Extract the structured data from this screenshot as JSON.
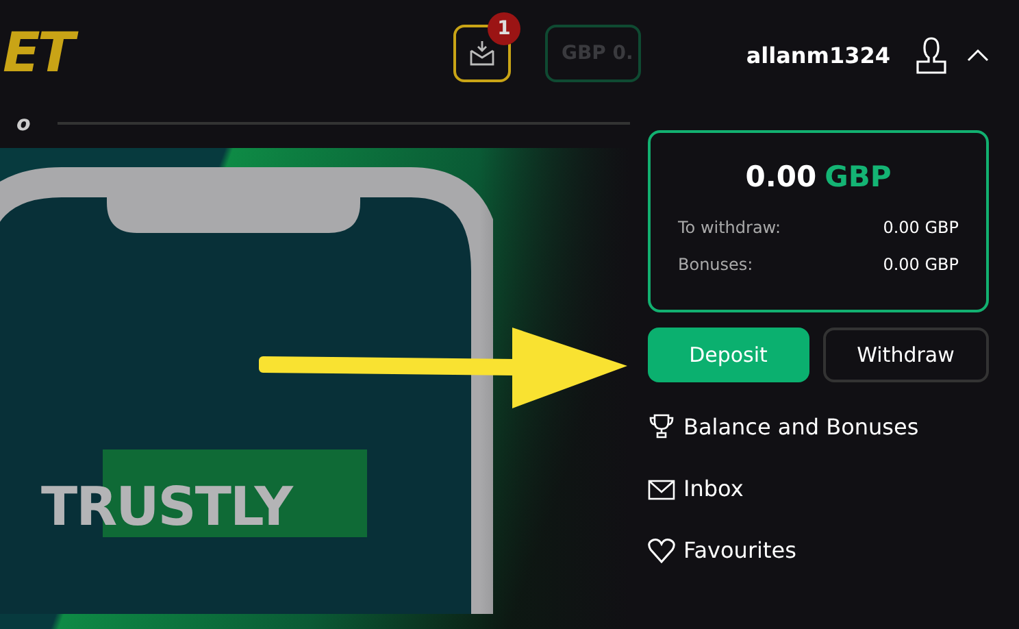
{
  "header": {
    "logo": "ET",
    "inbox": {
      "badge": "1"
    },
    "balance_button": "GBP 0.",
    "nav_item": "o"
  },
  "banner": {
    "headline": "TRUSTLY"
  },
  "account_menu": {
    "username": "allanm1324",
    "expanded": true,
    "balance": {
      "amount": "0.00",
      "currency": "GBP",
      "rows": [
        {
          "label": "To withdraw:",
          "value": "0.00 GBP"
        },
        {
          "label": "Bonuses:",
          "value": "0.00 GBP"
        }
      ]
    },
    "buttons": [
      {
        "label": "Deposit",
        "kind": "primary"
      },
      {
        "label": "Withdraw",
        "kind": "secondary"
      }
    ],
    "items": [
      {
        "label": "Balance and Bonuses"
      },
      {
        "label": "Inbox"
      },
      {
        "label": "Favourites"
      }
    ]
  }
}
